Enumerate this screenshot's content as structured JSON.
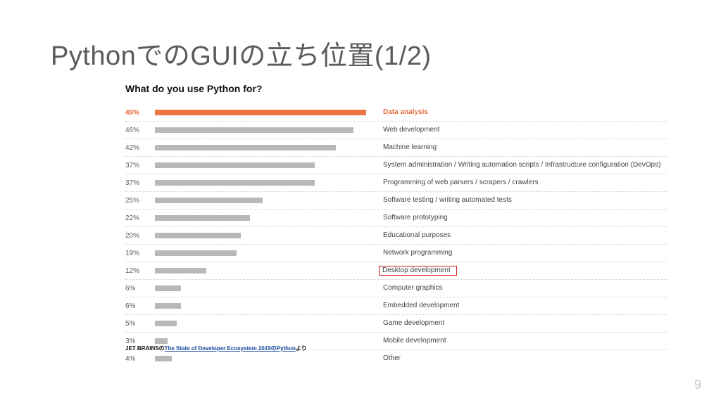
{
  "title": "PythonでのGUIの立ち位置(1/2)",
  "chart_title": "What do you use Python for?",
  "source": {
    "prefix": "JET BRAINSの",
    "link_text": "The State of Developer Ecosystem 2019のPython",
    "suffix": "より"
  },
  "page_number": "9",
  "chart_data": {
    "type": "bar",
    "title": "What do you use Python for?",
    "xlabel": "",
    "ylabel": "",
    "ylim": [
      0,
      49
    ],
    "categories": [
      "Data analysis",
      "Web development",
      "Machine learning",
      "System administration / Writing automation scripts / Infrastructure configuration (DevOps)",
      "Programming of web parsers / scrapers / crawlers",
      "Software testing / writing automated tests",
      "Software prototyping",
      "Educational purposes",
      "Network programming",
      "Desktop development",
      "Computer graphics",
      "Embedded development",
      "Game development",
      "Mobile development",
      "Other"
    ],
    "values": [
      49,
      46,
      42,
      37,
      37,
      25,
      22,
      20,
      19,
      12,
      6,
      6,
      5,
      3,
      4
    ],
    "highlight_index": 0,
    "boxed_index": 9
  }
}
